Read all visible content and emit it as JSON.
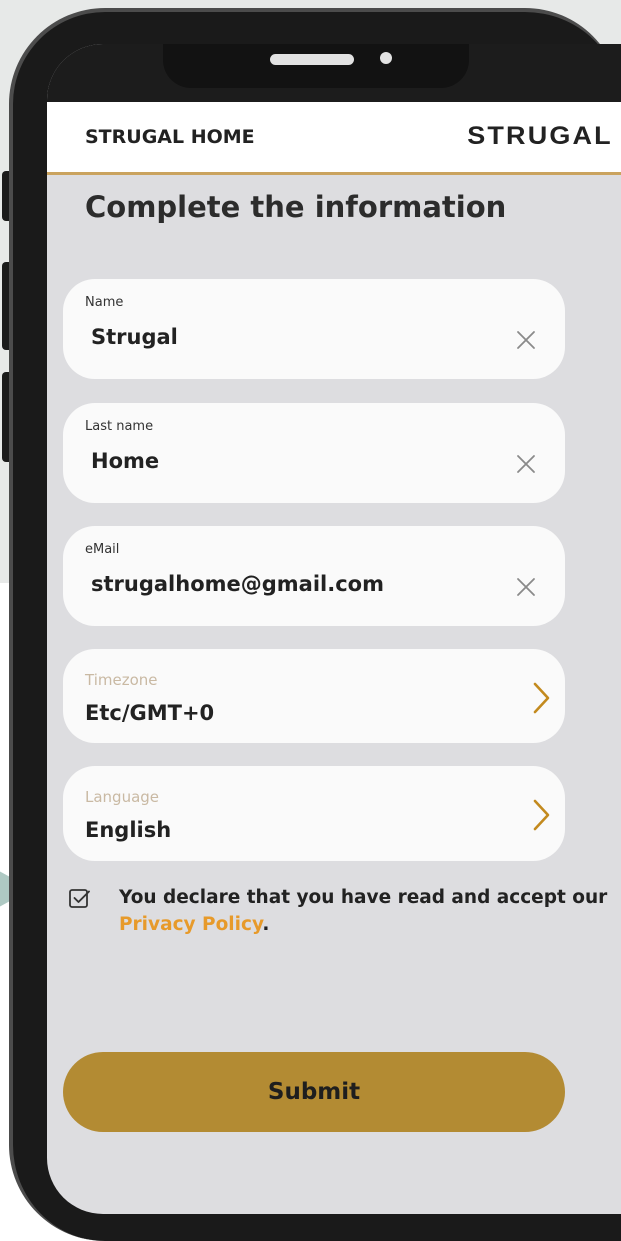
{
  "app": {
    "title": "STRUGAL HOME",
    "brand_logo": "STRUGAL"
  },
  "page": {
    "heading": "Complete the information"
  },
  "form": {
    "name": {
      "label": "Name",
      "value": "Strugal"
    },
    "last_name": {
      "label": "Last name",
      "value": "Home"
    },
    "email": {
      "label": "eMail",
      "value": "strugalhome@gmail.com"
    },
    "timezone": {
      "label": "Timezone",
      "value": "Etc/GMT+0"
    },
    "language": {
      "label": "Language",
      "value": "English"
    }
  },
  "consent": {
    "checked": true,
    "text": "You declare that you have read and accept our",
    "link": "Privacy Policy",
    "suffix": "."
  },
  "submit_label": "Submit",
  "icons": {
    "clear": "close-icon",
    "chevron": "chevron-right-icon",
    "checkbox": "checkbox-checked-icon"
  },
  "colors": {
    "accent": "#b38b33",
    "link": "#e79a2a",
    "appbar_border": "#caa35e",
    "screen_bg": "#dddde0",
    "field_bg": "#fafafa",
    "placeholder_label": "#c9b9a3"
  }
}
